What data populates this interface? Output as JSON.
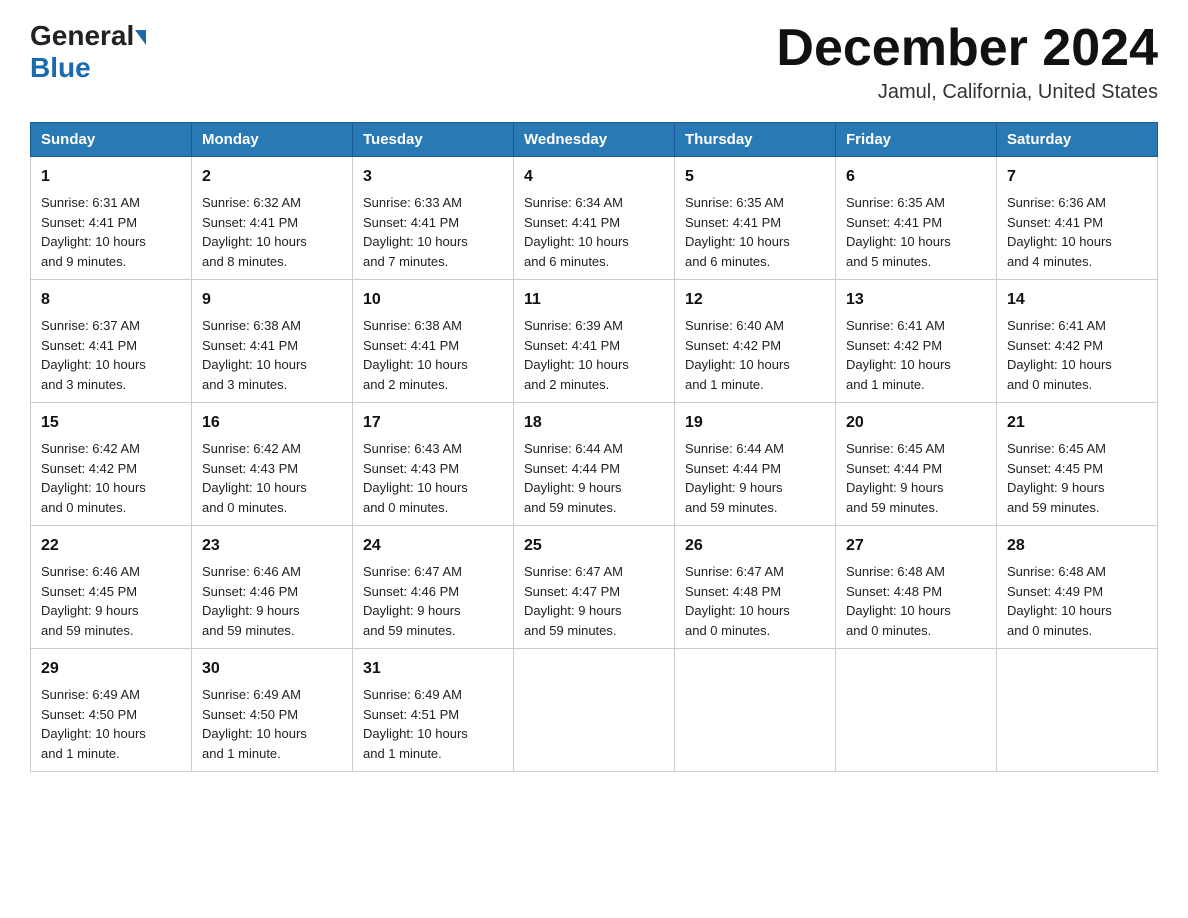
{
  "header": {
    "logo_general": "General",
    "logo_blue": "Blue",
    "title": "December 2024",
    "location": "Jamul, California, United States"
  },
  "days_of_week": [
    "Sunday",
    "Monday",
    "Tuesday",
    "Wednesday",
    "Thursday",
    "Friday",
    "Saturday"
  ],
  "weeks": [
    [
      {
        "day": "1",
        "info": "Sunrise: 6:31 AM\nSunset: 4:41 PM\nDaylight: 10 hours\nand 9 minutes."
      },
      {
        "day": "2",
        "info": "Sunrise: 6:32 AM\nSunset: 4:41 PM\nDaylight: 10 hours\nand 8 minutes."
      },
      {
        "day": "3",
        "info": "Sunrise: 6:33 AM\nSunset: 4:41 PM\nDaylight: 10 hours\nand 7 minutes."
      },
      {
        "day": "4",
        "info": "Sunrise: 6:34 AM\nSunset: 4:41 PM\nDaylight: 10 hours\nand 6 minutes."
      },
      {
        "day": "5",
        "info": "Sunrise: 6:35 AM\nSunset: 4:41 PM\nDaylight: 10 hours\nand 6 minutes."
      },
      {
        "day": "6",
        "info": "Sunrise: 6:35 AM\nSunset: 4:41 PM\nDaylight: 10 hours\nand 5 minutes."
      },
      {
        "day": "7",
        "info": "Sunrise: 6:36 AM\nSunset: 4:41 PM\nDaylight: 10 hours\nand 4 minutes."
      }
    ],
    [
      {
        "day": "8",
        "info": "Sunrise: 6:37 AM\nSunset: 4:41 PM\nDaylight: 10 hours\nand 3 minutes."
      },
      {
        "day": "9",
        "info": "Sunrise: 6:38 AM\nSunset: 4:41 PM\nDaylight: 10 hours\nand 3 minutes."
      },
      {
        "day": "10",
        "info": "Sunrise: 6:38 AM\nSunset: 4:41 PM\nDaylight: 10 hours\nand 2 minutes."
      },
      {
        "day": "11",
        "info": "Sunrise: 6:39 AM\nSunset: 4:41 PM\nDaylight: 10 hours\nand 2 minutes."
      },
      {
        "day": "12",
        "info": "Sunrise: 6:40 AM\nSunset: 4:42 PM\nDaylight: 10 hours\nand 1 minute."
      },
      {
        "day": "13",
        "info": "Sunrise: 6:41 AM\nSunset: 4:42 PM\nDaylight: 10 hours\nand 1 minute."
      },
      {
        "day": "14",
        "info": "Sunrise: 6:41 AM\nSunset: 4:42 PM\nDaylight: 10 hours\nand 0 minutes."
      }
    ],
    [
      {
        "day": "15",
        "info": "Sunrise: 6:42 AM\nSunset: 4:42 PM\nDaylight: 10 hours\nand 0 minutes."
      },
      {
        "day": "16",
        "info": "Sunrise: 6:42 AM\nSunset: 4:43 PM\nDaylight: 10 hours\nand 0 minutes."
      },
      {
        "day": "17",
        "info": "Sunrise: 6:43 AM\nSunset: 4:43 PM\nDaylight: 10 hours\nand 0 minutes."
      },
      {
        "day": "18",
        "info": "Sunrise: 6:44 AM\nSunset: 4:44 PM\nDaylight: 9 hours\nand 59 minutes."
      },
      {
        "day": "19",
        "info": "Sunrise: 6:44 AM\nSunset: 4:44 PM\nDaylight: 9 hours\nand 59 minutes."
      },
      {
        "day": "20",
        "info": "Sunrise: 6:45 AM\nSunset: 4:44 PM\nDaylight: 9 hours\nand 59 minutes."
      },
      {
        "day": "21",
        "info": "Sunrise: 6:45 AM\nSunset: 4:45 PM\nDaylight: 9 hours\nand 59 minutes."
      }
    ],
    [
      {
        "day": "22",
        "info": "Sunrise: 6:46 AM\nSunset: 4:45 PM\nDaylight: 9 hours\nand 59 minutes."
      },
      {
        "day": "23",
        "info": "Sunrise: 6:46 AM\nSunset: 4:46 PM\nDaylight: 9 hours\nand 59 minutes."
      },
      {
        "day": "24",
        "info": "Sunrise: 6:47 AM\nSunset: 4:46 PM\nDaylight: 9 hours\nand 59 minutes."
      },
      {
        "day": "25",
        "info": "Sunrise: 6:47 AM\nSunset: 4:47 PM\nDaylight: 9 hours\nand 59 minutes."
      },
      {
        "day": "26",
        "info": "Sunrise: 6:47 AM\nSunset: 4:48 PM\nDaylight: 10 hours\nand 0 minutes."
      },
      {
        "day": "27",
        "info": "Sunrise: 6:48 AM\nSunset: 4:48 PM\nDaylight: 10 hours\nand 0 minutes."
      },
      {
        "day": "28",
        "info": "Sunrise: 6:48 AM\nSunset: 4:49 PM\nDaylight: 10 hours\nand 0 minutes."
      }
    ],
    [
      {
        "day": "29",
        "info": "Sunrise: 6:49 AM\nSunset: 4:50 PM\nDaylight: 10 hours\nand 1 minute."
      },
      {
        "day": "30",
        "info": "Sunrise: 6:49 AM\nSunset: 4:50 PM\nDaylight: 10 hours\nand 1 minute."
      },
      {
        "day": "31",
        "info": "Sunrise: 6:49 AM\nSunset: 4:51 PM\nDaylight: 10 hours\nand 1 minute."
      },
      {
        "day": "",
        "info": ""
      },
      {
        "day": "",
        "info": ""
      },
      {
        "day": "",
        "info": ""
      },
      {
        "day": "",
        "info": ""
      }
    ]
  ]
}
